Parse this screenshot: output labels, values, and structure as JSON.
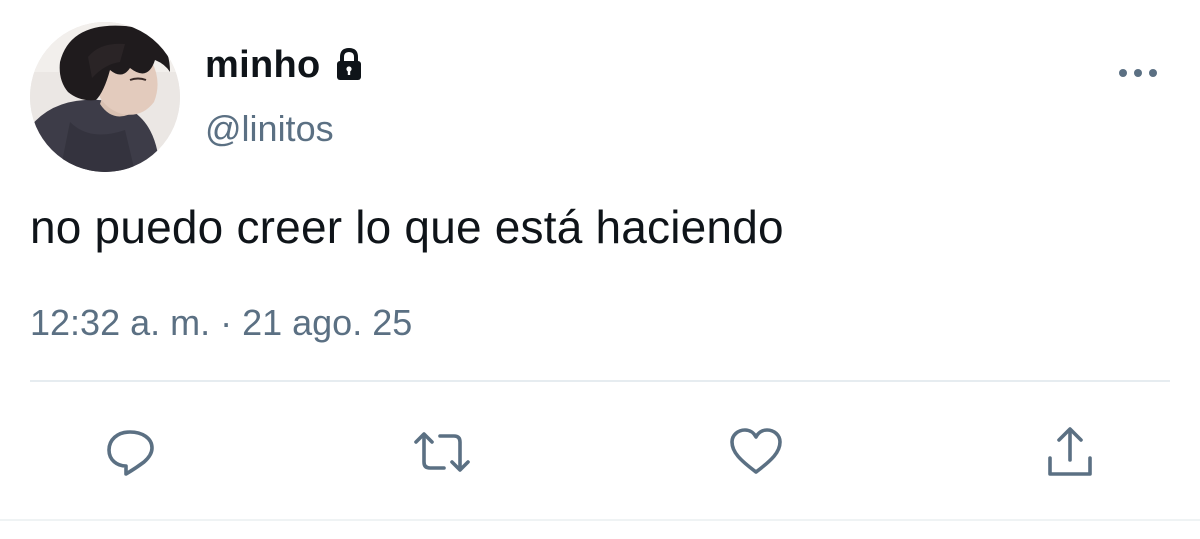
{
  "user": {
    "display_name": "minho",
    "handle": "@linitos",
    "protected_icon": "lock-icon",
    "avatar_alt": "profile photo"
  },
  "tweet": {
    "text": "no puedo creer lo que está haciendo",
    "timestamp": "12:32 a. m. · 21 ago. 25"
  },
  "menu": {
    "icon": "more-horizontal-icon"
  },
  "actions": [
    {
      "name": "reply",
      "icon": "reply-icon"
    },
    {
      "name": "retweet",
      "icon": "retweet-icon"
    },
    {
      "name": "like",
      "icon": "heart-icon"
    },
    {
      "name": "share",
      "icon": "share-icon"
    }
  ],
  "colors": {
    "text_primary": "#0f1419",
    "text_secondary": "#5b7083",
    "divider": "#e6ecf0"
  }
}
